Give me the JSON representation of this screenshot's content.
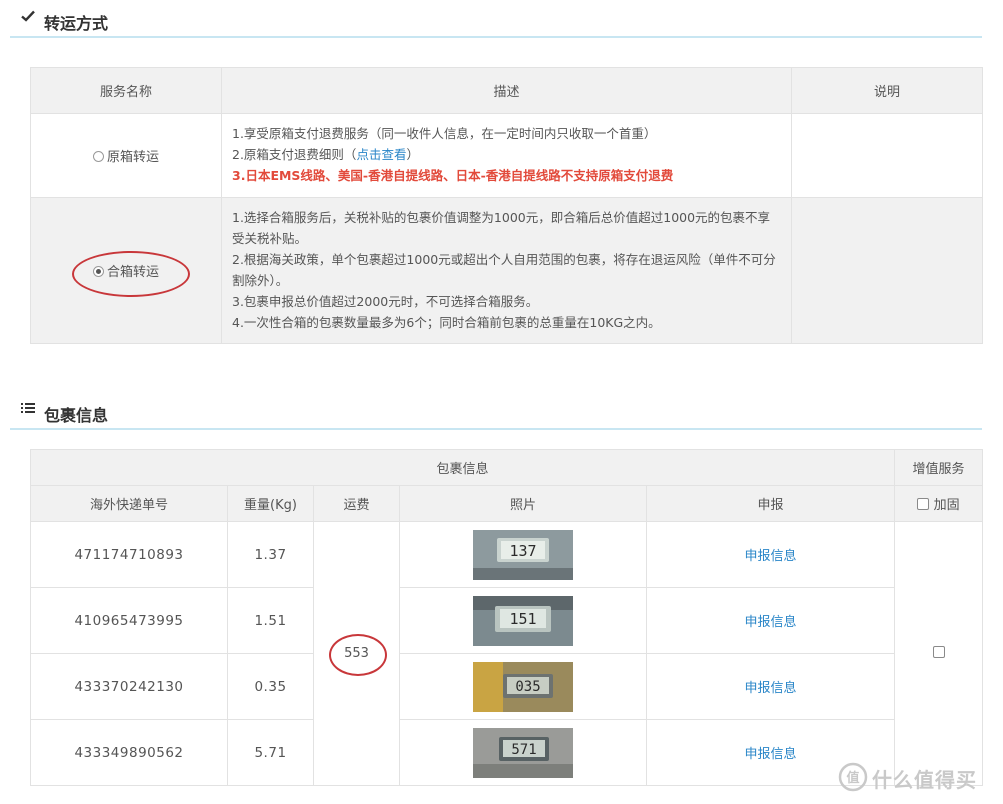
{
  "transfer_section": {
    "title": "转运方式",
    "headers": [
      "服务名称",
      "描述",
      "说明"
    ],
    "options": [
      {
        "name": "原箱转运",
        "selected": false,
        "lines": [
          "1.享受原箱支付退费服务（同一收件人信息，在一定时间内只收取一个首重）",
          "2.原箱支付退费细则（",
          "点击查看",
          "）",
          "3.日本EMS线路、美国-香港自提线路、日本-香港自提线路不支持原箱支付退费"
        ]
      },
      {
        "name": "合箱转运",
        "selected": true,
        "lines": [
          "1.选择合箱服务后，关税补贴的包裹价值调整为1000元，即合箱后总价值超过1000元的包裹不享受关税补贴。",
          "2.根据海关政策，单个包裹超过1000元或超出个人自用范围的包裹，将存在退运风险（单件不可分割除外）。",
          "3.包裹申报总价值超过2000元时，不可选择合箱服务。",
          "4.一次性合箱的包裹数量最多为6个；同时合箱前包裹的总重量在10KG之内。"
        ]
      }
    ]
  },
  "package_section": {
    "title": "包裹信息",
    "group_header": "包裹信息",
    "value_added_header": "增值服务",
    "columns": [
      "海外快递单号",
      "重量(Kg)",
      "运费",
      "照片",
      "申报"
    ],
    "reinforce_label": "加固",
    "shipping_fee": "553",
    "declare_label": "申报信息",
    "rows": [
      {
        "tracking": "471174710893",
        "weight": "1.37",
        "scale_reading": "137"
      },
      {
        "tracking": "410965473995",
        "weight": "1.51",
        "scale_reading": "151"
      },
      {
        "tracking": "433370242130",
        "weight": "0.35",
        "scale_reading": "035"
      },
      {
        "tracking": "433349890562",
        "weight": "5.71",
        "scale_reading": "571"
      }
    ]
  },
  "watermark": {
    "text": "什么值得买",
    "badge": "值"
  },
  "colors": {
    "accent_blue": "#2a86c8",
    "highlight_red": "#e24a3b",
    "annotation_red": "#c8373a",
    "header_gray": "#f1f1f1",
    "divider_blue": "#c8e6f2"
  }
}
